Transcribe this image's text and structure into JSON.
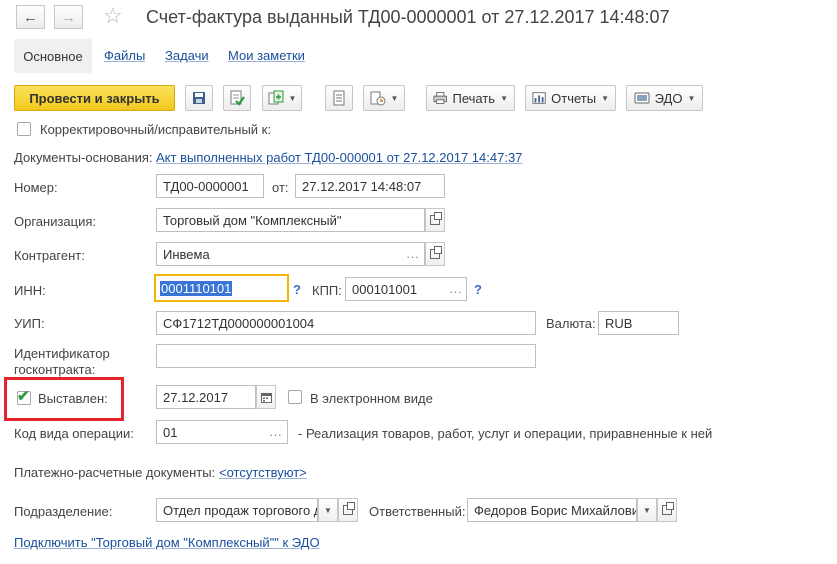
{
  "window": {
    "title": "Счет-фактура выданный ТД00-0000001 от 27.12.2017 14:48:07"
  },
  "icons": {
    "back": "arrow-left-icon",
    "forward": "arrow-right-icon",
    "favorite": "star-icon",
    "open": "open-external-icon",
    "select": "ellipsis-icon",
    "calendar": "calendar-icon"
  },
  "tabs": [
    {
      "label": "Основное"
    },
    {
      "label": "Файлы"
    },
    {
      "label": "Задачи"
    },
    {
      "label": "Мои заметки"
    }
  ],
  "toolbar": {
    "post_close_label": "Провести и закрыть",
    "print_label": "Печать",
    "reports_label": "Отчеты",
    "edo_label": "ЭДО"
  },
  "form": {
    "correction_label": "Корректировочный/исправительный к:",
    "base_docs_label": "Документы-основания:",
    "base_docs_link": "Акт выполненных работ ТД00-000001 от 27.12.2017 14:47:37",
    "number_label": "Номер:",
    "number_value": "ТД00-0000001",
    "date_label": "от:",
    "date_value": "27.12.2017 14:48:07",
    "org_label": "Организация:",
    "org_value": "Торговый дом \"Комплексный\"",
    "contractor_label": "Контрагент:",
    "contractor_value": "Инвема",
    "inn_label": "ИНН:",
    "inn_value": "0001110101",
    "kpp_label": "КПП:",
    "kpp_value": "000101001",
    "question_mark": "?",
    "uip_label": "УИП:",
    "uip_value": "СФ1712ТД000000001004",
    "currency_label": "Валюта:",
    "currency_value": "RUB",
    "gov_contract_label": "Идентификатор госконтракта:",
    "gov_contract_value": "",
    "issued_label": "Выставлен:",
    "issued_checked": true,
    "issued_date": "27.12.2017",
    "electronic_label": "В электронном виде",
    "op_code_label": "Код вида операции:",
    "op_code_value": "01",
    "op_code_desc": "- Реализация товаров, работ, услуг и операции, приравненные к ней",
    "payment_docs_label": "Платежно-расчетные документы:",
    "payment_docs_link": "<отсутствуют>",
    "department_label": "Подразделение:",
    "department_value": "Отдел продаж торгового д",
    "responsible_label": "Ответственный:",
    "responsible_value": "Федоров Борис Михайлови",
    "connect_edo_link": "Подключить \"Торговый дом \"Комплексный\"\" к ЭДО"
  },
  "colors": {
    "accent_yellow": "#f5d02a",
    "link_blue": "#1a4f9c",
    "highlight_red": "#e0262a",
    "focus_orange": "#f2b705",
    "selection_blue": "#3875d7",
    "check_green": "#2a9a3c"
  }
}
